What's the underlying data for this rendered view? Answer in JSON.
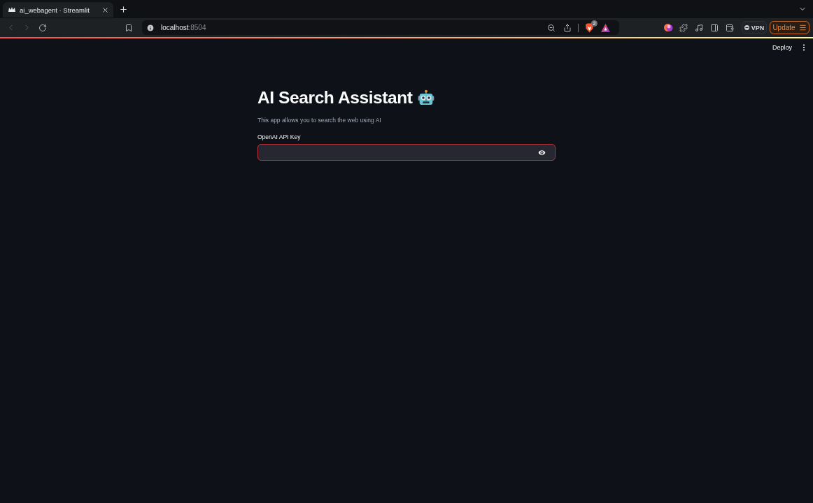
{
  "browser": {
    "tab": {
      "title": "ai_webagent · Streamlit"
    },
    "address_bar": {
      "host": "localhost",
      "port": ":8504"
    },
    "shields_count": "2",
    "vpn": "VPN",
    "update": "Update"
  },
  "app_header": {
    "deploy": "Deploy"
  },
  "main": {
    "title": "AI Search Assistant",
    "description": "This app allows you to search the web using AI",
    "api_key": {
      "label": "OpenAI API Key",
      "focused": true
    }
  }
}
